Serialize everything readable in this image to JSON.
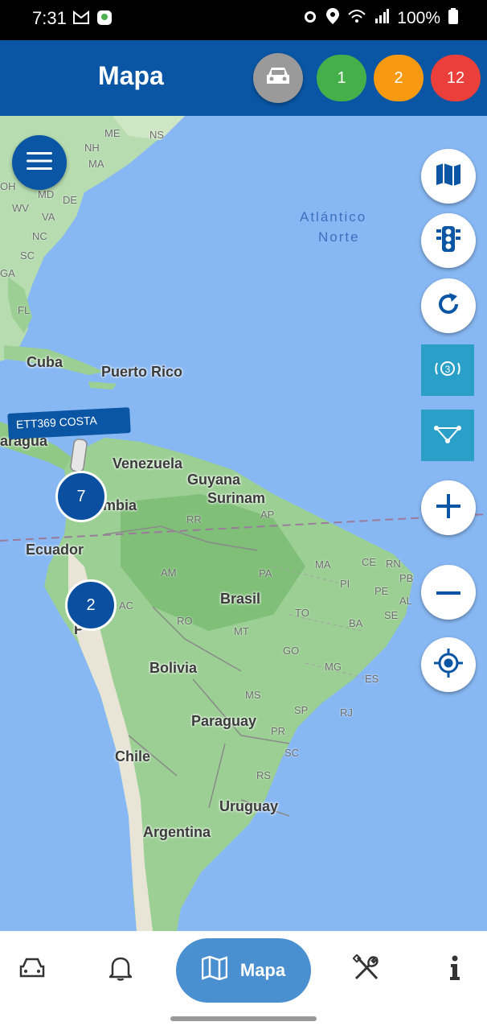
{
  "status_bar": {
    "time": "7:31",
    "battery": "100%"
  },
  "app_bar": {
    "title": "Mapa",
    "badges": [
      {
        "value": "1",
        "color": "#43b04a"
      },
      {
        "value": "2",
        "color": "#f79a12"
      },
      {
        "value": "12",
        "color": "#ea3f3a"
      }
    ]
  },
  "map": {
    "ocean_label_line1": "Atlántico",
    "ocean_label_line2": "Norte",
    "countries": [
      "Cuba",
      "Puerto Rico",
      "Venezuela",
      "Guyana",
      "Surinam",
      "Ecuador",
      "Brasil",
      "Bolivia",
      "Paraguay",
      "Chile",
      "Uruguay",
      "Argentina",
      "aragua",
      "mbia",
      "P"
    ],
    "states": [
      "ME",
      "NS",
      "NH",
      "MA",
      "OH",
      "MD",
      "DE",
      "WV",
      "VA",
      "NC",
      "SC",
      "GA",
      "FL",
      "RR",
      "AP",
      "AM",
      "PA",
      "MA",
      "CE",
      "RN",
      "PI",
      "PB",
      "PE",
      "AL",
      "SE",
      "AC",
      "RO",
      "TO",
      "BA",
      "MT",
      "GO",
      "MG",
      "ES",
      "MS",
      "SP",
      "RJ",
      "PR",
      "SC",
      "RS"
    ],
    "vehicle_label": "ETT369 COSTA",
    "clusters": [
      "7",
      "2"
    ]
  },
  "bottom_nav": {
    "active_label": "Mapa"
  }
}
